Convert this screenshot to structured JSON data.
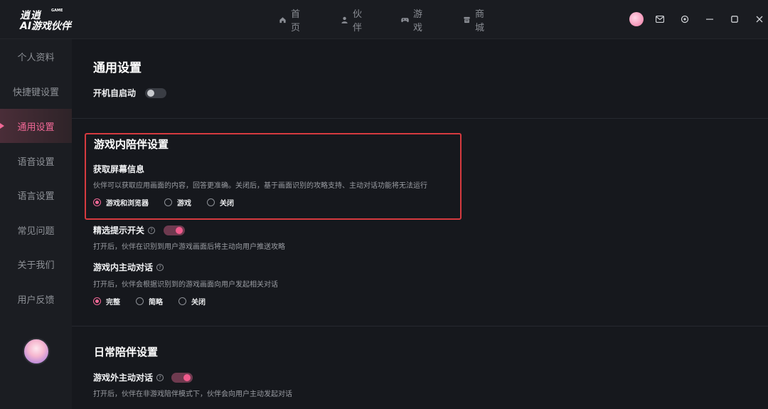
{
  "app": {
    "logo_line1": "逍逍",
    "logo_tag": "GAME",
    "logo_line2": "AI游戏伙伴"
  },
  "nav": [
    {
      "label": "首页",
      "icon": "home-icon"
    },
    {
      "label": "伙伴",
      "icon": "person-icon"
    },
    {
      "label": "游戏",
      "icon": "gamepad-icon"
    },
    {
      "label": "商城",
      "icon": "store-icon"
    }
  ],
  "sidebar": {
    "items": [
      {
        "label": "个人资料"
      },
      {
        "label": "快捷键设置"
      },
      {
        "label": "通用设置"
      },
      {
        "label": "语音设置"
      },
      {
        "label": "语言设置"
      },
      {
        "label": "常见问题"
      },
      {
        "label": "关于我们"
      },
      {
        "label": "用户反馈"
      }
    ],
    "active_index": 2
  },
  "general": {
    "title": "通用设置",
    "autostart_label": "开机自启动",
    "autostart_on": false
  },
  "ingame": {
    "title": "游戏内陪伴设置",
    "screen_label": "获取屏幕信息",
    "screen_desc": "伙伴可以获取应用画面的内容，回答更准确。关闭后，基于画面识别的攻略支持、主动对话功能将无法运行",
    "screen_options": [
      "游戏和浏览器",
      "游戏",
      "关闭"
    ],
    "screen_selected": "游戏和浏览器",
    "tips_label": "精选提示开关",
    "tips_on": true,
    "tips_desc": "打开后，伙伴在识别到用户游戏画面后将主动向用户推送攻略",
    "dialog_label": "游戏内主动对话",
    "dialog_desc": "打开后，伙伴会根据识别到的游戏画面向用户发起相关对话",
    "dialog_options": [
      "完整",
      "简略",
      "关闭"
    ],
    "dialog_selected": "完整"
  },
  "daily": {
    "title": "日常陪伴设置",
    "dialog_label": "游戏外主动对话",
    "dialog_on": true,
    "dialog_desc": "打开后，伙伴在非游戏陪伴模式下，伙伴会向用户主动发起对话"
  },
  "colors": {
    "accent": "#f06896",
    "highlight_border": "#d63a3f"
  }
}
